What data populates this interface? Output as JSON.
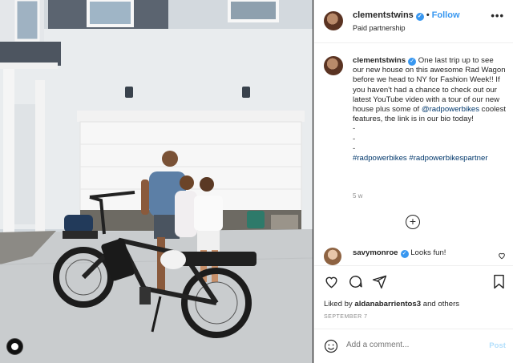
{
  "header": {
    "username": "clementstwins",
    "separator": "•",
    "follow_label": "Follow",
    "subtitle": "Paid partnership",
    "more_label": "•••"
  },
  "caption": {
    "username": "clementstwins",
    "body_lines": [
      "One last trip up to see our new house on this awesome Rad Wagon before we head to NY for Fashion Week!! If you haven't had a chance to check out our latest YouTube video with a tour of our new house plus some of ",
      "@radpowerbikes",
      " coolest features, the link is in our bio today!"
    ],
    "dashes": [
      "-",
      "-",
      "-"
    ],
    "hashtags": [
      "#radpowerbikes",
      "#radpowerbikespartner"
    ],
    "time": "5 w"
  },
  "load_more_label": "+",
  "comment": {
    "username": "savymonroe",
    "text": "Looks fun!"
  },
  "likes": {
    "prefix": "Liked by ",
    "username": "aldanabarrientos3",
    "suffix": " and others"
  },
  "date": "SEPTEMBER 7",
  "add_comment": {
    "placeholder": "Add a comment...",
    "post_label": "Post"
  },
  "colors": {
    "verified": "#3897f0",
    "follow": "#3897f0",
    "hashtag": "#00376b",
    "post_disabled": "#b2dffc"
  },
  "icons": [
    "verified-badge-icon",
    "more-options-icon",
    "heart-icon",
    "comment-icon",
    "share-icon",
    "bookmark-icon",
    "emoji-icon",
    "add-circle-icon"
  ]
}
